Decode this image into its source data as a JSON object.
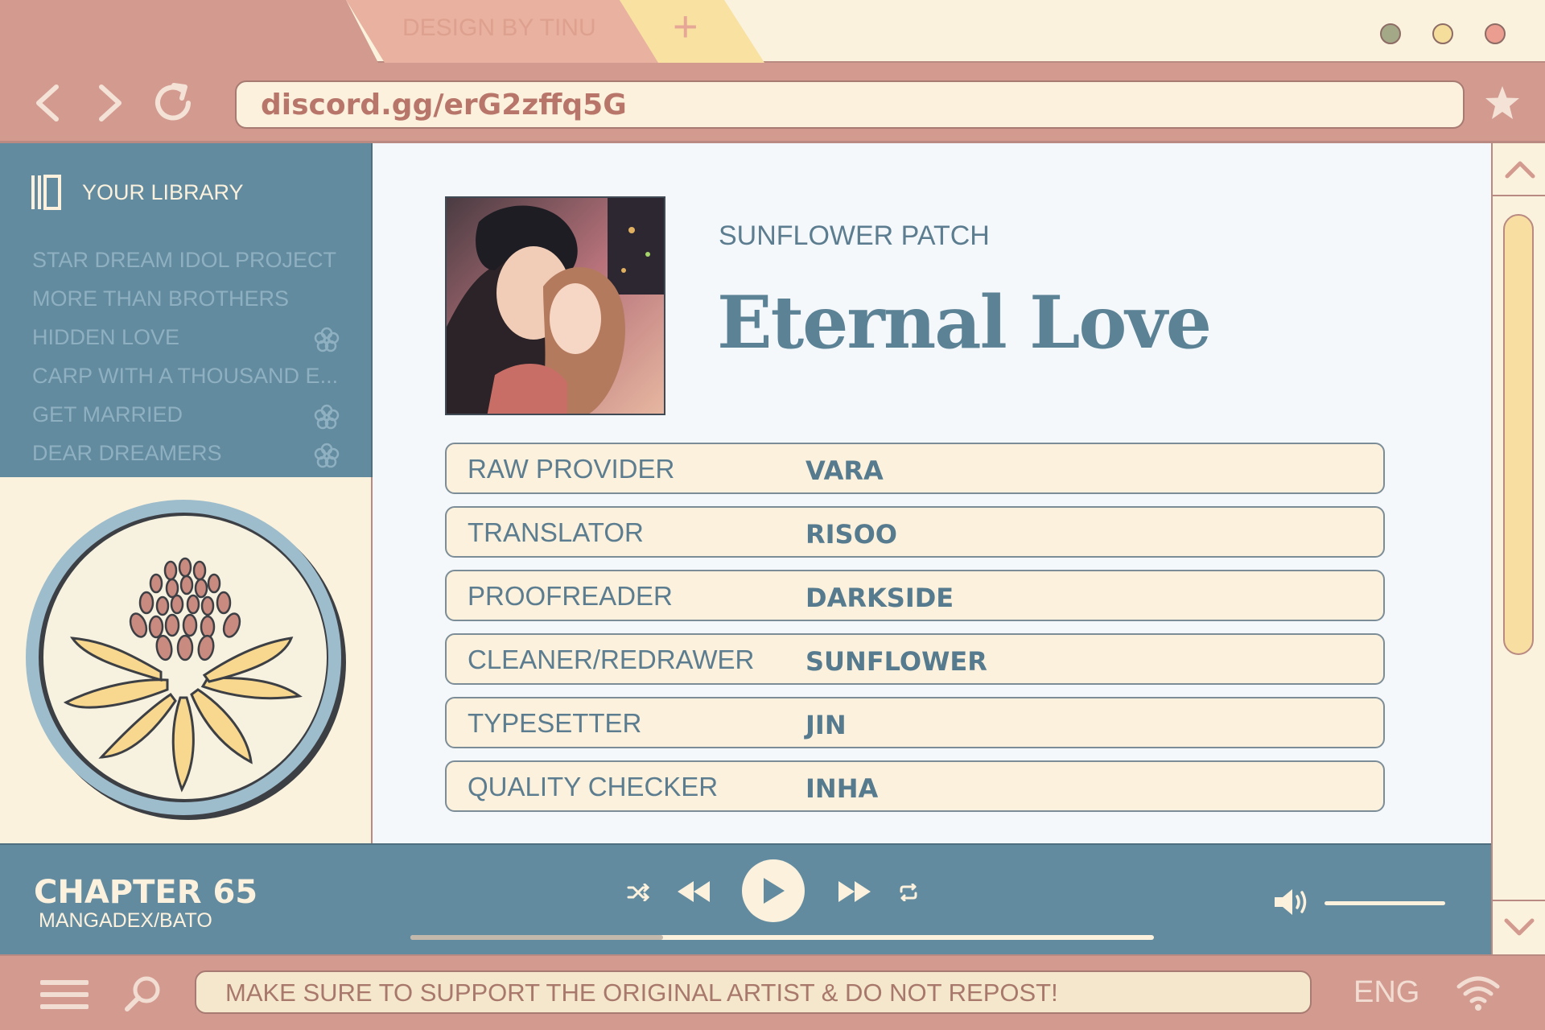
{
  "tabs": {
    "design_label": "DESIGN BY TINU",
    "new_tab_symbol": "+"
  },
  "nav": {
    "url": "discord.gg/erG2zffq5G"
  },
  "library": {
    "title": "YOUR LIBRARY",
    "items": [
      {
        "label": "STAR DREAM IDOL PROJECT",
        "flower": false
      },
      {
        "label": "MORE THAN BROTHERS",
        "flower": false
      },
      {
        "label": "HIDDEN LOVE",
        "flower": true
      },
      {
        "label": "CARP WITH A THOUSAND E...",
        "flower": false
      },
      {
        "label": "GET MARRIED",
        "flower": true
      },
      {
        "label": "DEAR DREAMERS",
        "flower": true
      }
    ]
  },
  "main": {
    "group": "SUNFLOWER PATCH",
    "title": "Eternal Love",
    "credits": [
      {
        "role": "RAW PROVIDER",
        "name": "VARA"
      },
      {
        "role": "TRANSLATOR",
        "name": "RISOO"
      },
      {
        "role": "PROOFREADER",
        "name": "DARKSIDE"
      },
      {
        "role": "CLEANER/REDRAWER",
        "name": "SUNFLOWER"
      },
      {
        "role": "TYPESETTER",
        "name": "JIN"
      },
      {
        "role": "QUALITY CHECKER",
        "name": "INHA"
      }
    ]
  },
  "player": {
    "chapter": "CHAPTER 65",
    "source": "MANGADEX/BATO",
    "progress": 0.34,
    "volume": 1.0
  },
  "status": {
    "notice": "MAKE SURE TO SUPPORT THE ORIGINAL ARTIST & DO NOT REPOST!",
    "language": "ENG"
  },
  "colors": {
    "frame_pink": "#d39a90",
    "cream": "#faf2dc",
    "teal": "#628b9f",
    "yellow": "#f8dea0",
    "window_dots": [
      "#a3a987",
      "#f5dd9b",
      "#eb9d8f"
    ]
  }
}
